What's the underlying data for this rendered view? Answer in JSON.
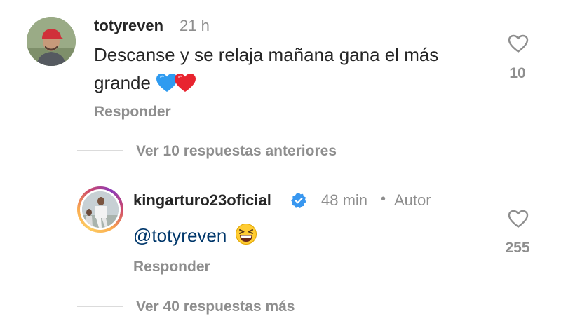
{
  "comment": {
    "username": "totyreven",
    "time": "21 h",
    "text_line1": "Descanse y se relaja mañana gana el más",
    "text_line2": "grande",
    "like_count": "10",
    "reply_label": "Responder"
  },
  "thread": {
    "view_previous_label": "Ver 10 respuestas anteriores",
    "view_more_label": "Ver 40 respuestas más"
  },
  "reply": {
    "username": "kingarturo23oficial",
    "time": "48 min",
    "separator": "•",
    "author_label": "Autor",
    "mention": "@totyreven",
    "like_count": "255",
    "reply_label": "Responder"
  },
  "icons": {
    "heart": "heart-outline-icon",
    "verified": "verified-badge-icon",
    "blue_heart": "blue-heart-emoji",
    "red_heart": "red-heart-emoji",
    "laughing": "grinning-squinting-emoji"
  },
  "colors": {
    "text": "#262626",
    "secondary": "#8e8e8e",
    "mention": "#00376b",
    "verified": "#3897f0"
  }
}
